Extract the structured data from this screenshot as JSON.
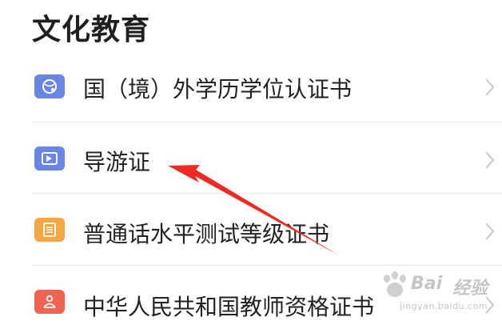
{
  "section": {
    "title": "文化教育"
  },
  "items": [
    {
      "label": "国（境）外学历学位认证书",
      "icon": "globe-certificate-icon",
      "color": "#5b7fe0"
    },
    {
      "label": "导游证",
      "icon": "tour-guide-card-icon",
      "color": "#5b7fe0"
    },
    {
      "label": "普通话水平测试等级证书",
      "icon": "mandarin-test-certificate-icon",
      "color": "#f0a33b"
    },
    {
      "label": "中华人民共和国教师资格证书",
      "icon": "teacher-qualification-icon",
      "color": "#ee5b47"
    }
  ],
  "annotation": {
    "arrow_color": "#ee2a24"
  },
  "watermark": {
    "brand": "Bai",
    "brand_suffix": "经验",
    "url": "jingyan.baidu.com"
  }
}
